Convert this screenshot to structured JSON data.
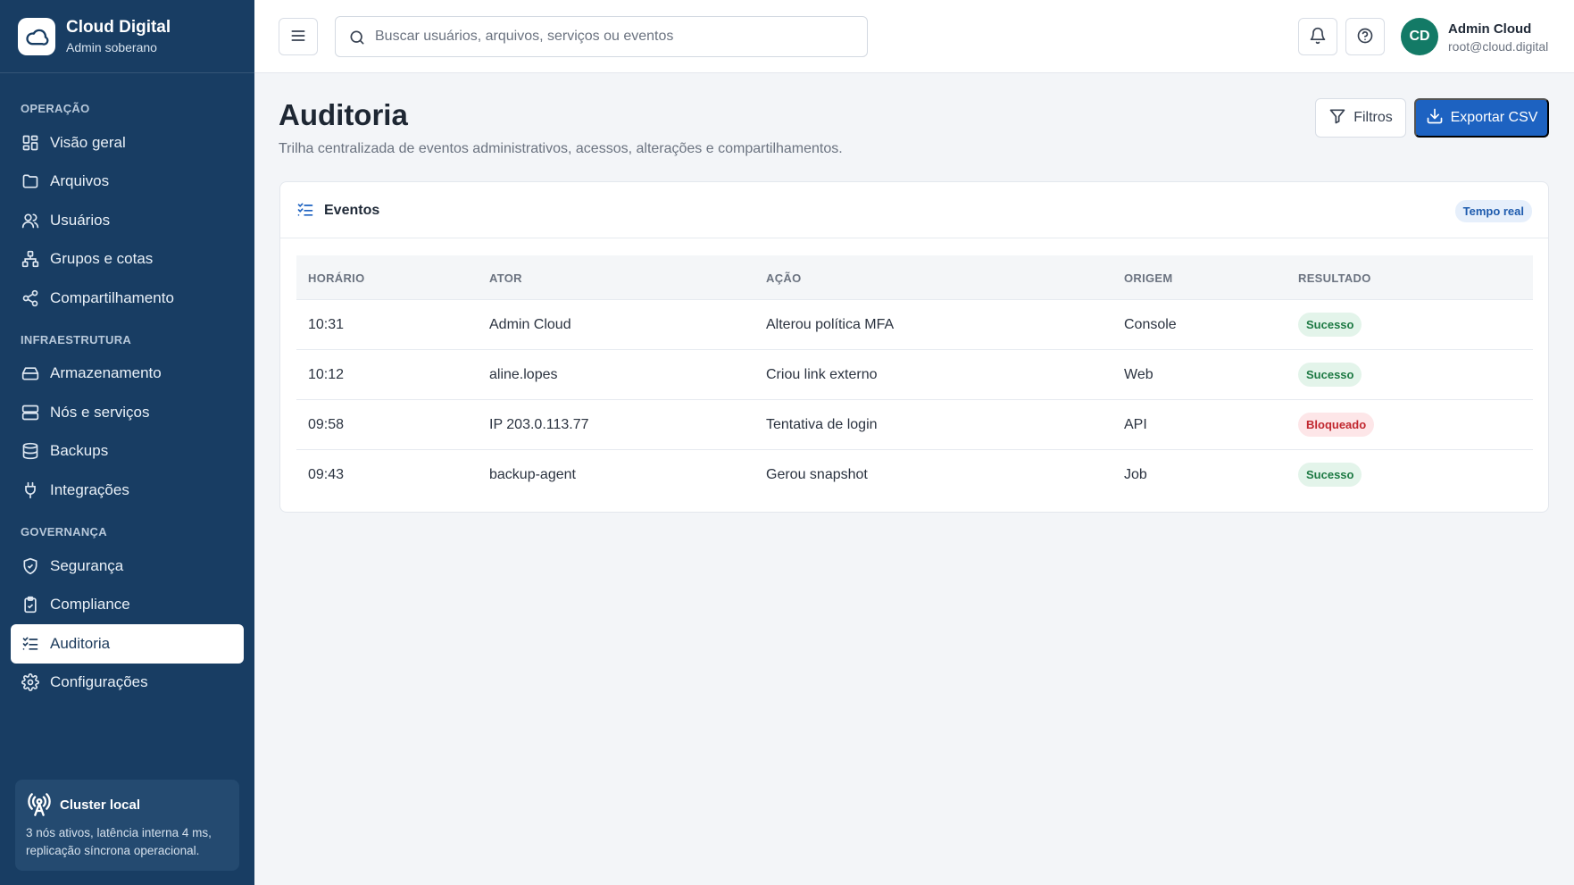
{
  "brand": {
    "name": "Cloud Digital",
    "subtitle": "Admin soberano"
  },
  "sidebar": {
    "sections": [
      {
        "title": "OPERAÇÃO"
      },
      {
        "title": "INFRAESTRUTURA"
      },
      {
        "title": "GOVERNANÇA"
      }
    ],
    "items": [
      {
        "label": "Visão geral",
        "icon": "grid-icon"
      },
      {
        "label": "Arquivos",
        "icon": "folder-icon"
      },
      {
        "label": "Usuários",
        "icon": "users-icon"
      },
      {
        "label": "Grupos e cotas",
        "icon": "hierarchy-icon"
      },
      {
        "label": "Compartilhamento",
        "icon": "share-icon"
      },
      {
        "label": "Armazenamento",
        "icon": "hard-drive-icon"
      },
      {
        "label": "Nós e serviços",
        "icon": "server-icon"
      },
      {
        "label": "Backups",
        "icon": "database-icon"
      },
      {
        "label": "Integrações",
        "icon": "plug-icon"
      },
      {
        "label": "Segurança",
        "icon": "shield-icon"
      },
      {
        "label": "Compliance",
        "icon": "clipboard-check-icon"
      },
      {
        "label": "Auditoria",
        "icon": "list-checks-icon",
        "active": true
      },
      {
        "label": "Configurações",
        "icon": "gear-icon"
      }
    ],
    "cluster": {
      "title": "Cluster local",
      "description": "3 nós ativos, latência interna 4 ms, replicação síncrona operacional."
    }
  },
  "topbar": {
    "search_placeholder": "Buscar usuários, arquivos, serviços ou eventos",
    "user": {
      "initials": "CD",
      "name": "Admin Cloud",
      "email": "root@cloud.digital"
    }
  },
  "page": {
    "title": "Auditoria",
    "description": "Trilha centralizada de eventos administrativos, acessos, alterações e compartilhamentos.",
    "filter_label": "Filtros",
    "export_label": "Exportar CSV"
  },
  "events": {
    "title": "Eventos",
    "badge": "Tempo real",
    "columns": [
      "HORÁRIO",
      "ATOR",
      "AÇÃO",
      "ORIGEM",
      "RESULTADO"
    ],
    "rows": [
      {
        "time": "10:31",
        "actor": "Admin Cloud",
        "action": "Alterou política MFA",
        "origin": "Console",
        "result": "Sucesso"
      },
      {
        "time": "10:12",
        "actor": "aline.lopes",
        "action": "Criou link externo",
        "origin": "Web",
        "result": "Sucesso"
      },
      {
        "time": "09:58",
        "actor": "IP 203.0.113.77",
        "action": "Tentativa de login",
        "origin": "API",
        "result": "Bloqueado"
      },
      {
        "time": "09:43",
        "actor": "backup-agent",
        "action": "Gerou snapshot",
        "origin": "Job",
        "result": "Sucesso"
      }
    ]
  },
  "colors": {
    "sidebar": "#183d63",
    "accent": "#1d62c1",
    "success": "#1e7a44",
    "danger": "#c1272f",
    "avatar": "#137a66"
  }
}
